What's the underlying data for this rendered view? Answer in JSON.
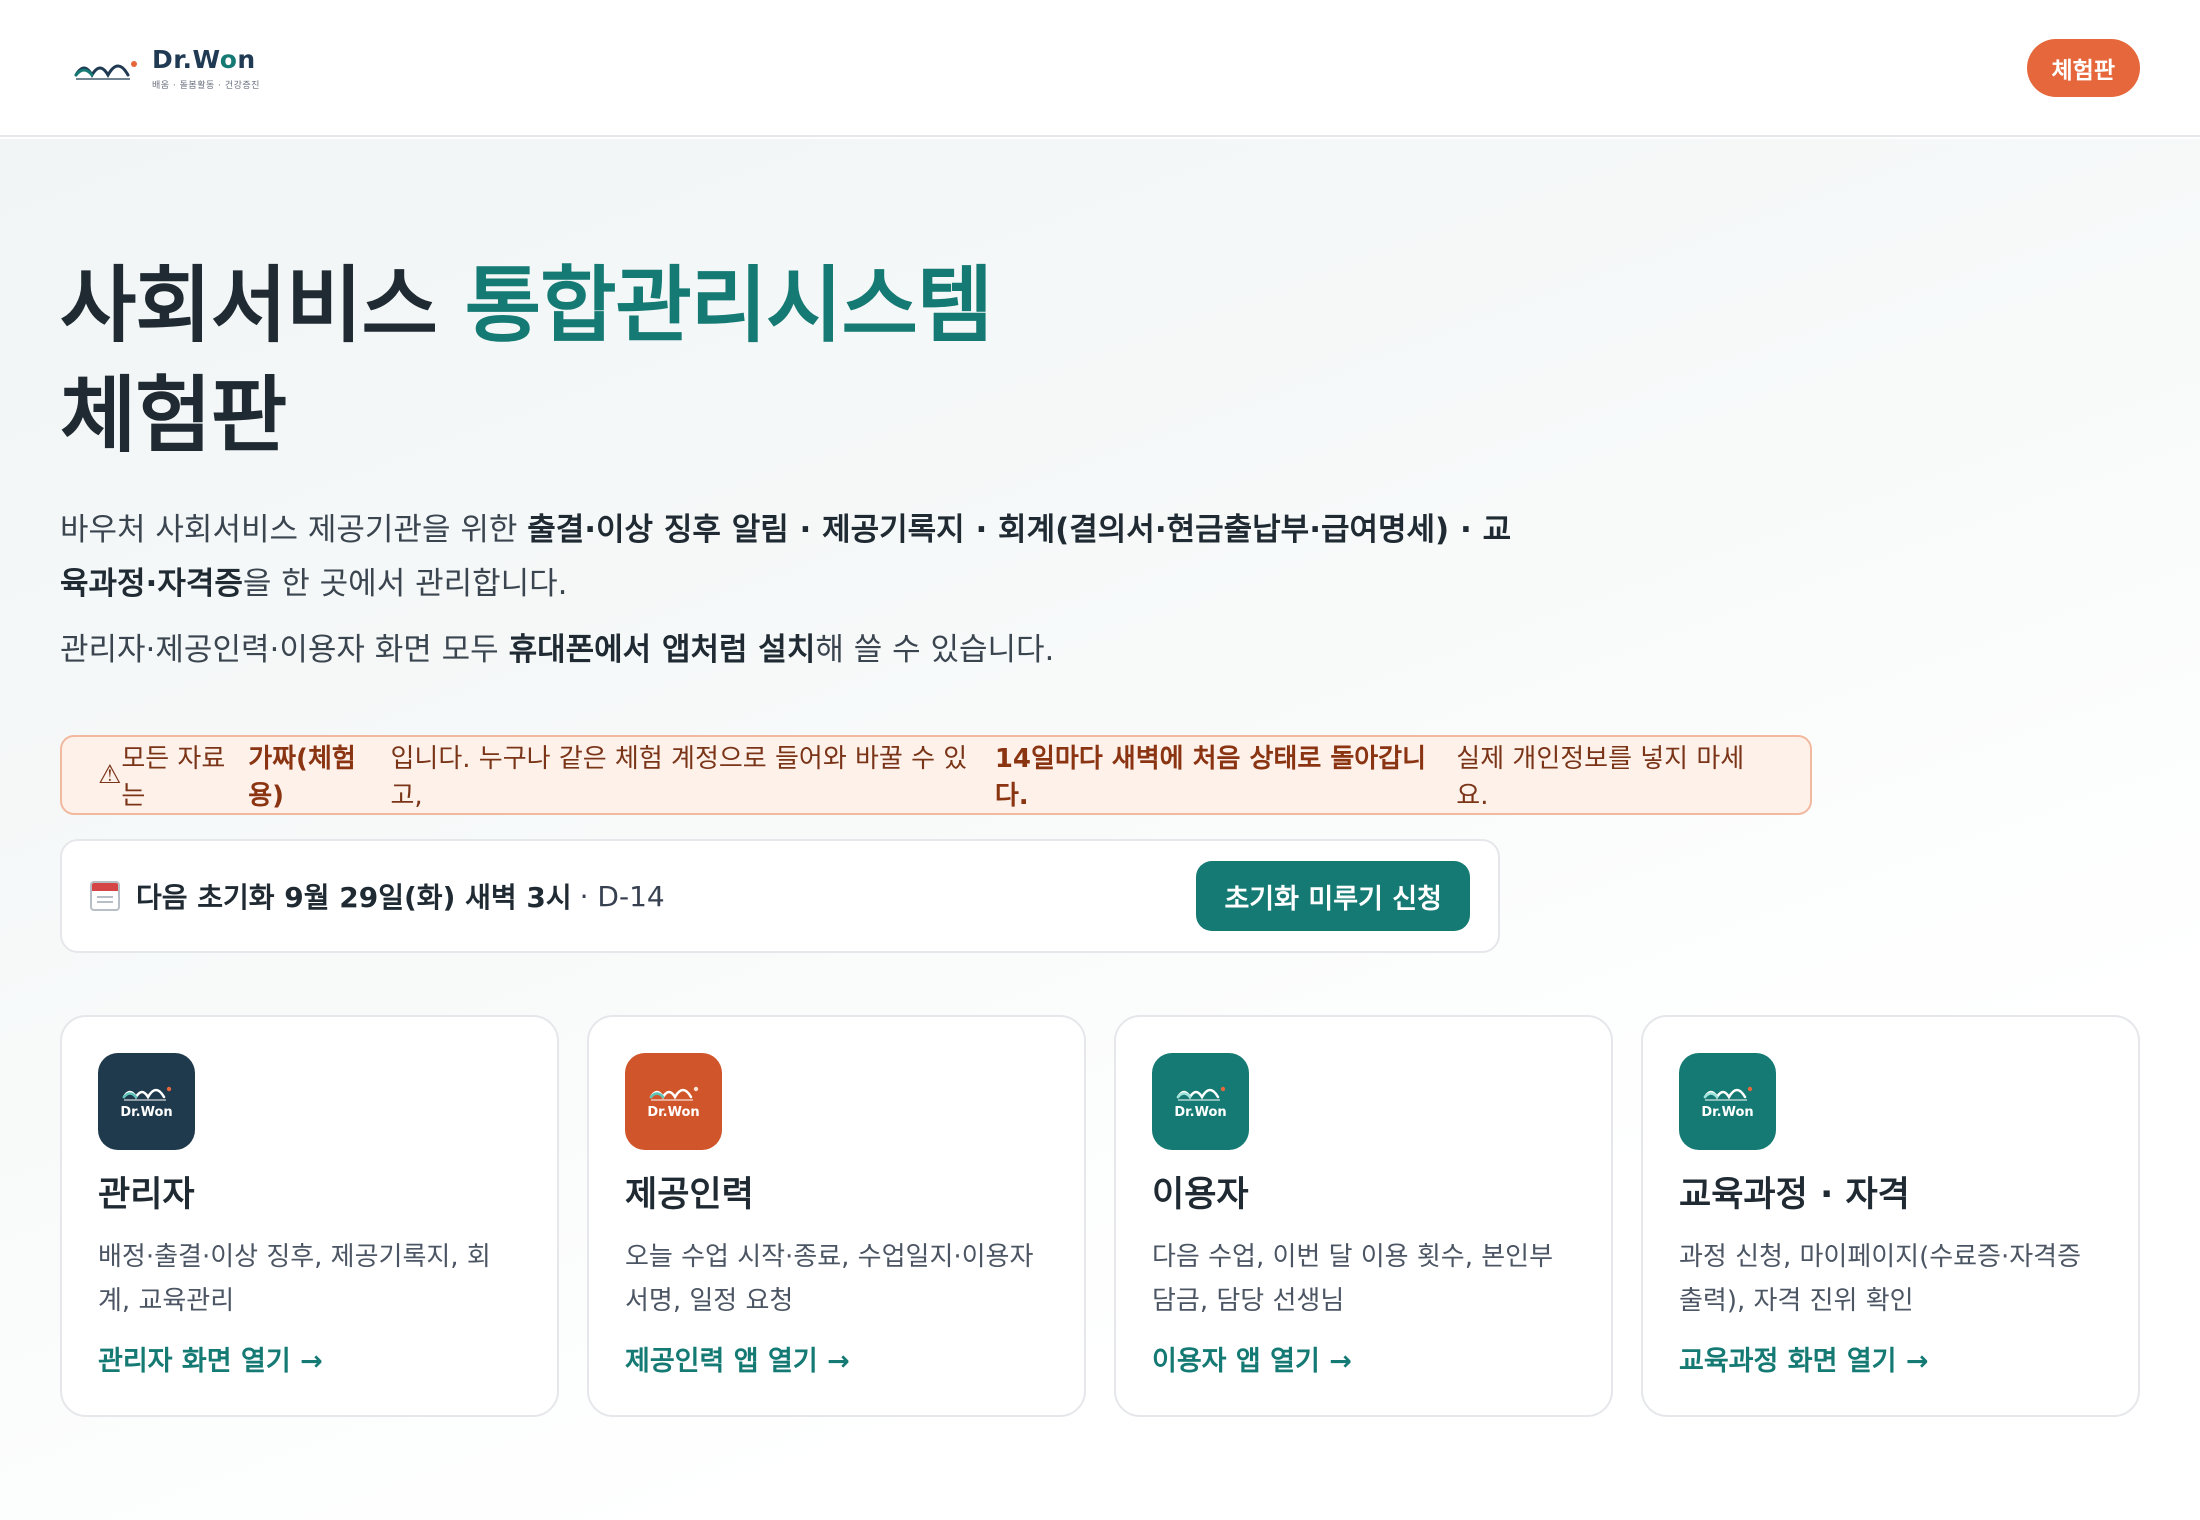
{
  "header": {
    "logo_name_pre": "Dr.W",
    "logo_name_o": "o",
    "logo_name_post": "n",
    "logo_tagline": "배움 · 돌봄활동 · 건강증진",
    "badge": "체험판"
  },
  "hero": {
    "title_part1": "사회서비스 ",
    "title_accent": "통합관리시스템",
    "title_line2": "체험판",
    "desc_p1": "바우처 사회서비스 제공기관을 위한 ",
    "desc_b1": "출결·이상 징후 알림 · 제공기록지 · 회계(결의서·현금출납부·급여명세) · 교육과정·자격증",
    "desc_p2": "을 한 곳에서 관리합니다.",
    "desc2_p1": "관리자·제공인력·이용자 화면 모두 ",
    "desc2_b1": "휴대폰에서 앱처럼 설치",
    "desc2_p2": "해 쓸 수 있습니다."
  },
  "warning": {
    "icon": "⚠",
    "p1": " 모든 자료는 ",
    "b1": "가짜(체험용)",
    "p2": "입니다. 누구나 같은 체험 계정으로 들어와 바꿀 수 있고, ",
    "b2": "14일마다 새벽에 처음 상태로 돌아갑니다.",
    "p3": " 실제 개인정보를 넣지 마세요."
  },
  "reset": {
    "label_bold": "다음 초기화 9월 29일(화) 새벽 3시",
    "dday": "· D-14",
    "button": "초기화 미루기 신청"
  },
  "cards": [
    {
      "icon_color": "#1f3a4d",
      "icon_label": "Dr.Won",
      "title": "관리자",
      "desc": "배정·출결·이상 징후, 제공기록지, 회계, 교육관리",
      "link": "관리자 화면 열기 →"
    },
    {
      "icon_color": "#d1552b",
      "icon_label": "Dr.Won",
      "title": "제공인력",
      "desc": "오늘 수업 시작·종료, 수업일지·이용자 서명, 일정 요청",
      "link": "제공인력 앱 열기 →"
    },
    {
      "icon_color": "#147a73",
      "icon_label": "Dr.Won",
      "title": "이용자",
      "desc": "다음 수업, 이번 달 이용 횟수, 본인부담금, 담당 선생님",
      "link": "이용자 앱 열기 →"
    },
    {
      "icon_color": "#147a73",
      "icon_label": "Dr.Won",
      "title": "교육과정 · 자격",
      "desc": "과정 신청, 마이페이지(수료증·자격증 출력), 자격 진위 확인",
      "link": "교육과정 화면 열기 →"
    }
  ]
}
